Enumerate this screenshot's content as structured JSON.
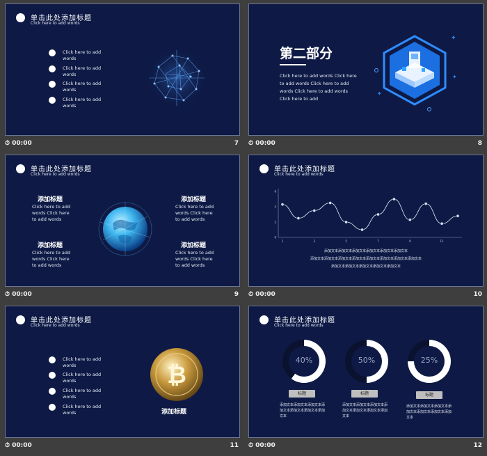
{
  "slides": [
    {
      "number": "7",
      "time": "00:00",
      "title_cn": "单击此处添加标题",
      "title_en": "Click here to add words",
      "bullets": [
        "Click here to add words",
        "Click here to add words",
        "Click here to add words",
        "Click here to add words"
      ]
    },
    {
      "number": "8",
      "time": "00:00",
      "section_title": "第二部分",
      "body": "Click here to add words Click here to add words Click here to add words Click here to add words Click here to add"
    },
    {
      "number": "9",
      "time": "00:00",
      "title_cn": "单击此处添加标题",
      "title_en": "Click here to add words",
      "blocks": [
        {
          "heading": "添加标题",
          "text": "Click here to add words Click here to add words"
        },
        {
          "heading": "添加标题",
          "text": "Click here to add words Click here to add words"
        },
        {
          "heading": "添加标题",
          "text": "Click here to add words Click here to add words"
        },
        {
          "heading": "添加标题",
          "text": "Click here to add words Click here to add words"
        }
      ]
    },
    {
      "number": "10",
      "time": "00:00",
      "title_cn": "单击此处添加标题",
      "title_en": "Click here to add words",
      "caption": [
        "添加文本添加文本添加文本添加文本添加文本添加文本",
        "添加文本添加文本添加文本添加文本添加文本添加文本添加文本添加文本",
        "添加文本添加文本添加文本添加文本添加文本"
      ]
    },
    {
      "number": "11",
      "time": "00:00",
      "title_cn": "单击此处添加标题",
      "title_en": "Click here to add words",
      "bullets": [
        "Click here to add words",
        "Click here to add words",
        "Click here to add words",
        "Click here to add words"
      ],
      "coin_label": "添加标题"
    },
    {
      "number": "12",
      "time": "00:00",
      "title_cn": "单击此处添加标题",
      "title_en": "Click here to add words",
      "rings": [
        {
          "percent": 40,
          "label": "40%",
          "tag": "标题",
          "text": "添加文本添加文本添加文本添加文本添加文本添加文本添加文本"
        },
        {
          "percent": 50,
          "label": "50%",
          "tag": "标题",
          "text": "添加文本添加文本添加文本添加文本添加文本添加文本添加文本"
        },
        {
          "percent": 25,
          "label": "25%",
          "tag": "标题",
          "text": "添加文本添加文本添加文本添加文本添加文本添加文本添加文本"
        }
      ]
    }
  ],
  "chart_data": {
    "type": "line",
    "x": [
      1,
      2,
      3,
      4,
      5,
      6,
      7,
      8,
      9,
      10,
      11,
      12
    ],
    "x_tick_labels": [
      "1",
      "3",
      "5",
      "7",
      "9",
      "11"
    ],
    "y_tick_labels": [
      "0",
      "2",
      "4",
      "6"
    ],
    "values": [
      4.3,
      2.5,
      3.5,
      4.5,
      2.0,
      1.0,
      3.0,
      5.0,
      2.3,
      4.4,
      1.8,
      2.8
    ],
    "ylim": [
      0,
      6
    ],
    "grid": false
  },
  "colors": {
    "slide_bg": "#0e1a45",
    "accent": "#1e90ff",
    "line": "#cfd6ea"
  }
}
